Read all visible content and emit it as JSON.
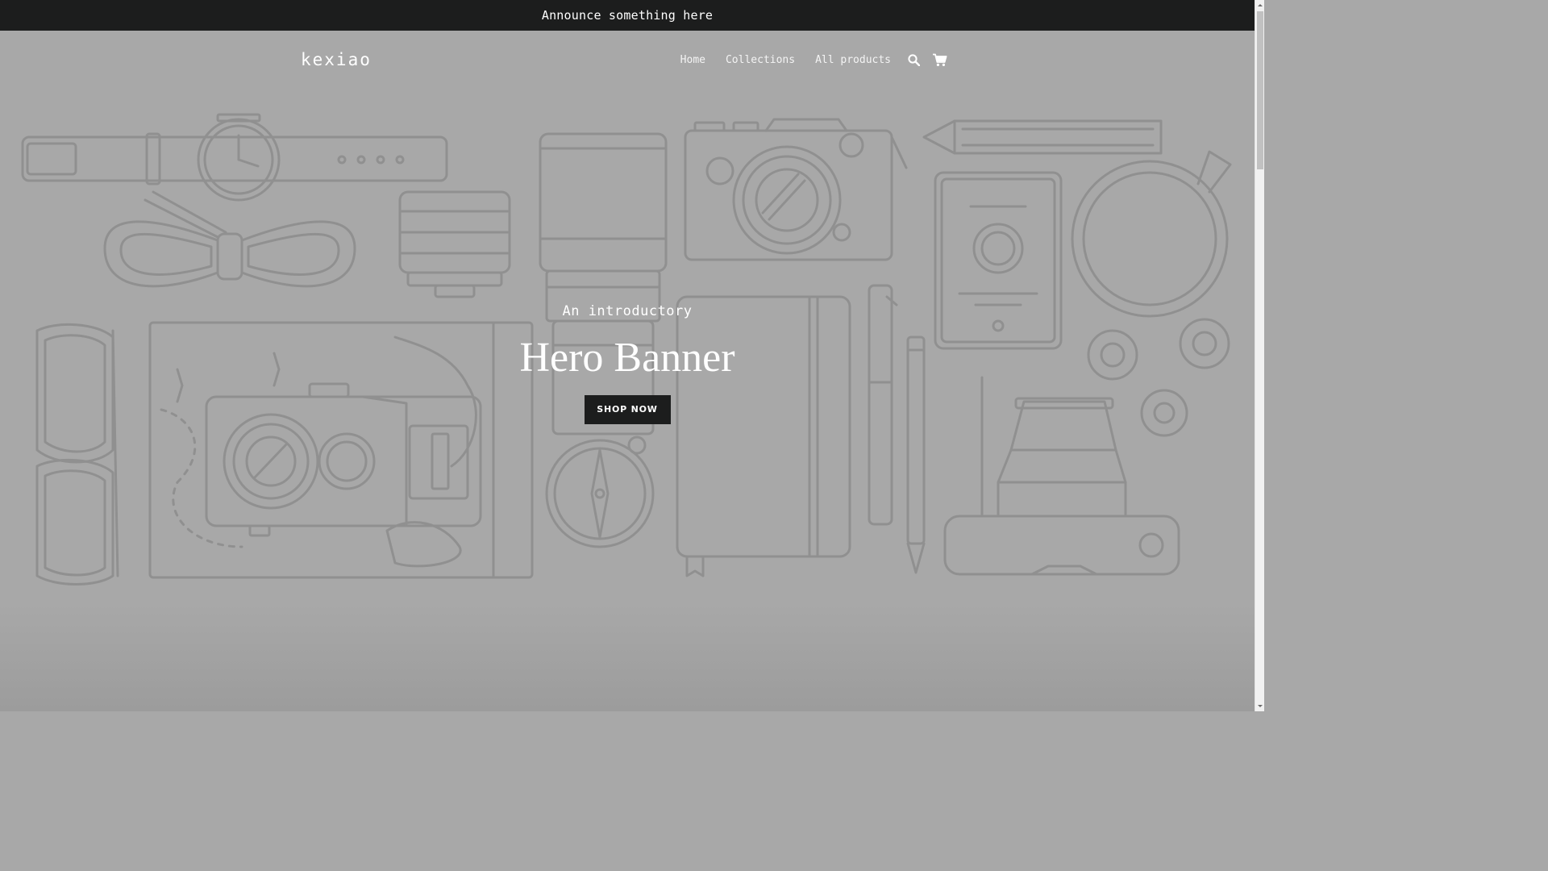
{
  "announcement": {
    "text": "Announce something here"
  },
  "header": {
    "logo": "kexiao",
    "nav": [
      {
        "label": "Home"
      },
      {
        "label": "Collections"
      },
      {
        "label": "All products"
      }
    ],
    "icons": [
      "search-icon",
      "cart-icon"
    ]
  },
  "hero": {
    "subtitle": "An introductory",
    "title": "Hero Banner",
    "button_label": "SHOP NOW",
    "overlay_color": "#a8a8a8",
    "button_color": "#1c1d1d"
  },
  "colors": {
    "announcement_bg": "#1c1d1d",
    "text_light": "#ffffff",
    "illustration_stroke": "#8f8f8f"
  }
}
